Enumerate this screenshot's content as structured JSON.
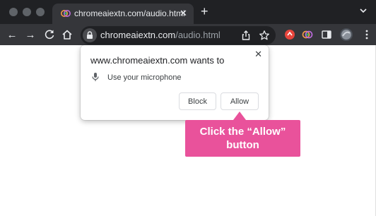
{
  "tab": {
    "title": "chromeaiextn.com/audio.html",
    "close_glyph": "✕"
  },
  "toolbar": {
    "new_tab_glyph": "+",
    "back_glyph": "←",
    "forward_glyph": "→",
    "url_host": "chromeaiextn.com",
    "url_path": "/audio.html"
  },
  "popup": {
    "title": "www.chromeaiextn.com wants to",
    "close_glyph": "✕",
    "permission": "Use your microphone",
    "block_label": "Block",
    "allow_label": "Allow"
  },
  "callout": {
    "line1": "Click the “Allow”",
    "line2": "button"
  },
  "colors": {
    "tab_strip": "#202124",
    "toolbar": "#35363a",
    "callout": "#e9529b"
  }
}
